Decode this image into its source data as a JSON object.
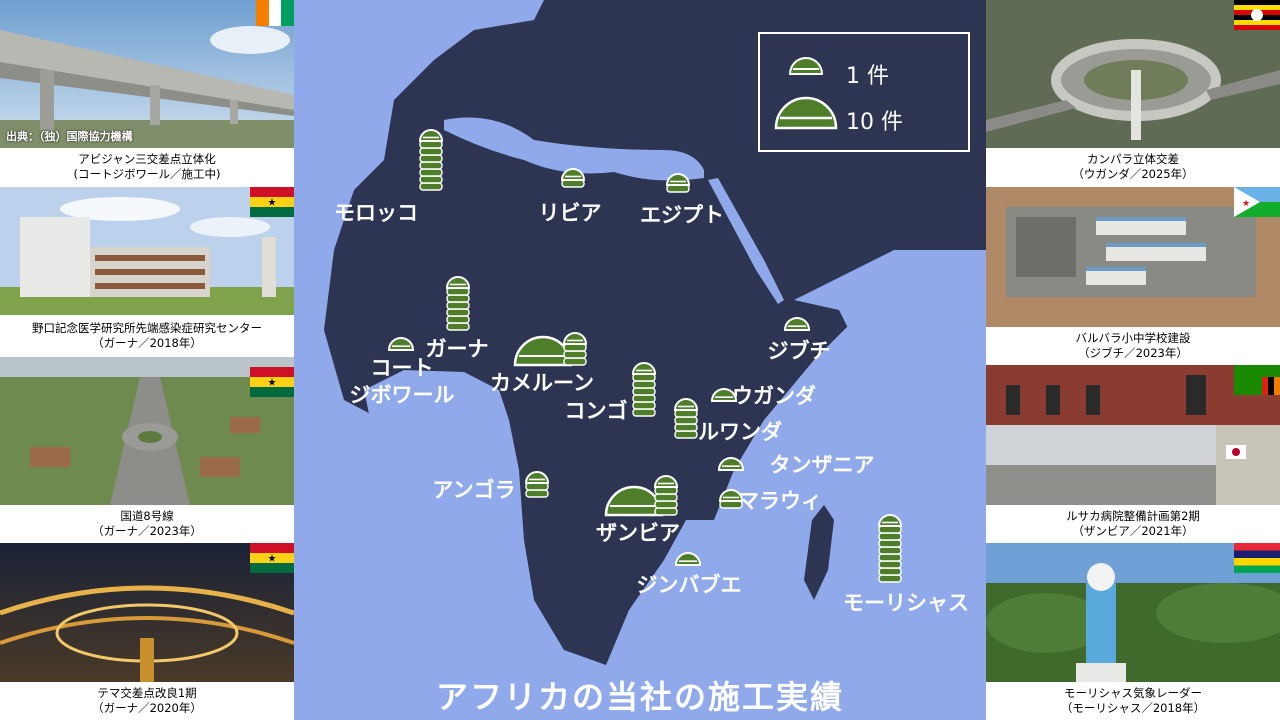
{
  "title": "アフリカの当社の施工実績",
  "legend": {
    "one": "1 件",
    "ten": "10 件"
  },
  "credit": "出典：（独）国際協力機構",
  "colors": {
    "ocean": "#8fa9ea",
    "land": "#2d3552",
    "marker": "#4e7e2a",
    "title": "#ffffff"
  },
  "chart_data": {
    "type": "map",
    "unit": "件",
    "countries": [
      {
        "name": "モロッコ",
        "count": 8
      },
      {
        "name": "リビア",
        "count": 2
      },
      {
        "name": "エジプト",
        "count": 2
      },
      {
        "name": "ガーナ",
        "count": 7
      },
      {
        "name": "コート\nジボワール",
        "count": 1
      },
      {
        "name": "カメルーン",
        "count": 14
      },
      {
        "name": "コンゴ",
        "count": 7
      },
      {
        "name": "ジブチ",
        "count": 1
      },
      {
        "name": "ウガンダ",
        "count": 1
      },
      {
        "name": "ルワンダ",
        "count": 5
      },
      {
        "name": "タンザニア",
        "count": 1
      },
      {
        "name": "アンゴラ",
        "count": 3
      },
      {
        "name": "ザンビア",
        "count": 15
      },
      {
        "name": "マラウィ",
        "count": 2
      },
      {
        "name": "ジンバブエ",
        "count": 1
      },
      {
        "name": "モーリシャス",
        "count": 9
      }
    ]
  },
  "photos_left": [
    {
      "title": "アビジャン三交差点立体化",
      "sub": "(コートジボワール／施工中)",
      "flag": "civ"
    },
    {
      "title": "野口記念医学研究所先端感染症研究センター",
      "sub": "（ガーナ／2018年）",
      "flag": "gha"
    },
    {
      "title": "国道8号線",
      "sub": "（ガーナ／2023年）",
      "flag": "gha"
    },
    {
      "title": "テマ交差点改良1期",
      "sub": "（ガーナ／2020年）",
      "flag": "gha"
    }
  ],
  "photos_right": [
    {
      "title": "カンパラ立体交差",
      "sub": "（ウガンダ／2025年）",
      "flag": "uga"
    },
    {
      "title": "バルバラ小中学校建設",
      "sub": "（ジブチ／2023年）",
      "flag": "dji"
    },
    {
      "title": "ルサカ病院整備計画第2期",
      "sub": "（ザンビア／2021年）",
      "flag": "zmb"
    },
    {
      "title": "モーリシャス気象レーダー",
      "sub": "（モーリシャス／2018年）",
      "flag": "mus"
    }
  ]
}
